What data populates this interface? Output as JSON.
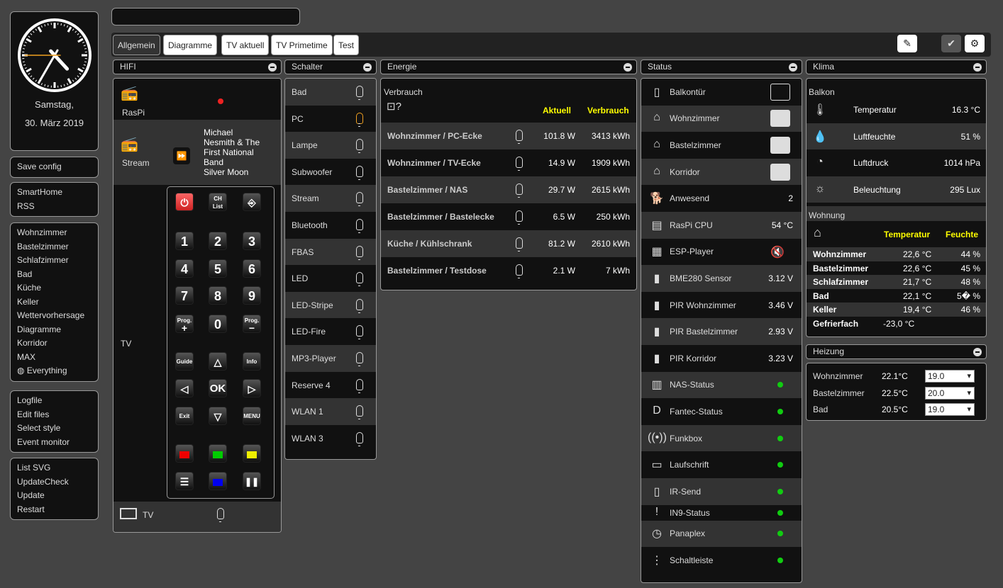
{
  "clock": {
    "day": "Samstag,",
    "date": "30. März 2019",
    "hour": 4.58,
    "minute": 35,
    "second": 45
  },
  "menus": {
    "group1": [
      "Save config"
    ],
    "group2": [
      "SmartHome",
      "RSS"
    ],
    "group3": [
      "Wohnzimmer",
      "Bastelzimmer",
      "Schlafzimmer",
      "Bad",
      "Küche",
      "Keller",
      "Wettervorhersage",
      "Diagramme",
      "Korridor",
      "MAX",
      "Everything"
    ],
    "group4": [
      "Logfile",
      "Edit files",
      "Select style",
      "Event monitor"
    ],
    "group5": [
      "List SVG",
      "UpdateCheck",
      "Update",
      "Restart"
    ]
  },
  "tabs": [
    "Allgemein",
    "Diagramme",
    "TV aktuell",
    "TV Primetime",
    "Test"
  ],
  "toolbar": {
    "edit_icon": "pencil-icon",
    "check_icon": "check-icon",
    "settings_icon": "gear-icon"
  },
  "hifi": {
    "title": "HIFI",
    "raspi": "RasPi",
    "stream": "Stream",
    "track": [
      "Michael",
      "Nesmith & The",
      "First National",
      "Band",
      "Silver Moon"
    ],
    "tv": "TV",
    "tv_bottom": "TV",
    "remote": {
      "ch_list": "CH List",
      "keys": [
        "1",
        "2",
        "3",
        "4",
        "5",
        "6",
        "7",
        "8",
        "9",
        "0"
      ],
      "prog_plus": "Prog.",
      "prog_minus": "Prog.",
      "guide": "Guide",
      "info": "Info",
      "ok": "OK",
      "exit": "Exit",
      "menu": "MENU"
    }
  },
  "schalter": {
    "title": "Schalter",
    "items": [
      {
        "label": "Bad",
        "on": false
      },
      {
        "label": "PC",
        "on": true
      },
      {
        "label": "Lampe",
        "on": false
      },
      {
        "label": "Subwoofer",
        "on": false
      },
      {
        "label": "Stream",
        "on": false
      },
      {
        "label": "Bluetooth",
        "on": false
      },
      {
        "label": "FBAS",
        "on": false
      },
      {
        "label": "LED",
        "on": false
      },
      {
        "label": "LED-Stripe",
        "on": false
      },
      {
        "label": "LED-Fire",
        "on": false
      },
      {
        "label": "MP3-Player",
        "on": false
      },
      {
        "label": "Reserve 4",
        "on": false
      },
      {
        "label": "WLAN 1",
        "on": false
      },
      {
        "label": "WLAN 3",
        "on": false
      }
    ]
  },
  "energie": {
    "title": "Energie",
    "section": "Verbrauch",
    "col_aktuell": "Aktuell",
    "col_verbrauch": "Verbrauch",
    "rows": [
      {
        "name": "Wohnzimmer / PC-Ecke",
        "aktuell": "101.8 W",
        "verbrauch": "3413 kWh"
      },
      {
        "name": "Wohnzimmer / TV-Ecke",
        "aktuell": "14.9 W",
        "verbrauch": "1909 kWh"
      },
      {
        "name": "Bastelzimmer / NAS",
        "aktuell": "29.7 W",
        "verbrauch": "2615 kWh"
      },
      {
        "name": "Bastelzimmer / Bastelecke",
        "aktuell": "6.5 W",
        "verbrauch": "250 kWh"
      },
      {
        "name": "Küche / Kühlschrank",
        "aktuell": "81.2 W",
        "verbrauch": "2610 kWh"
      },
      {
        "name": "Bastelzimmer / Testdose",
        "aktuell": "2.1 W",
        "verbrauch": "7 kWh"
      }
    ]
  },
  "status": {
    "title": "Status",
    "rows": [
      {
        "label": "Balkontür",
        "value": "",
        "icon": "door-icon"
      },
      {
        "label": "Wohnzimmer",
        "value": "",
        "icon": "home-icon"
      },
      {
        "label": "Bastelzimmer",
        "value": "",
        "icon": "absent-icon"
      },
      {
        "label": "Korridor",
        "value": "",
        "icon": "absent-icon"
      },
      {
        "label": "Anwesend",
        "value": "2",
        "icon": "dog-icon"
      },
      {
        "label": "RasPi CPU",
        "value": "54 °C",
        "icon": "sd-card-icon"
      },
      {
        "label": "ESP-Player",
        "value": "",
        "icon": "radio-icon"
      },
      {
        "label": "BME280 Sensor",
        "value": "3.12 V",
        "icon": "battery-icon"
      },
      {
        "label": "PIR Wohnzimmer",
        "value": "3.46 V",
        "icon": "battery-icon"
      },
      {
        "label": "PIR Bastelzimmer",
        "value": "2.93 V",
        "icon": "battery-icon"
      },
      {
        "label": "PIR Korridor",
        "value": "3.23 V",
        "icon": "battery-icon"
      },
      {
        "label": "NAS-Status",
        "value": "",
        "icon": "nas-icon"
      },
      {
        "label": "Fantec-Status",
        "value": "",
        "icon": "dvb-icon"
      },
      {
        "label": "Funkbox",
        "value": "",
        "icon": "antenna-icon"
      },
      {
        "label": "Laufschrift",
        "value": "",
        "icon": "display-icon"
      },
      {
        "label": "IR-Send",
        "value": "",
        "icon": "remote-icon"
      },
      {
        "label": "IN9-Status",
        "value": "",
        "icon": "thermometer-icon"
      },
      {
        "label": "Panaplex",
        "value": "",
        "icon": "stopwatch-icon"
      },
      {
        "label": "Schaltleiste",
        "value": "",
        "icon": "power-strip-icon"
      }
    ]
  },
  "klima": {
    "title": "Klima",
    "balkon": "Balkon",
    "balkon_rows": [
      {
        "label": "Temperatur",
        "value": "16.3 °C"
      },
      {
        "label": "Luftfeuchte",
        "value": "51 %"
      },
      {
        "label": "Luftdruck",
        "value": "1014 hPa"
      },
      {
        "label": "Beleuchtung",
        "value": "295 Lux"
      }
    ],
    "wohnung": "Wohnung",
    "col_temp": "Temperatur",
    "col_feuchte": "Feuchte",
    "wohnung_rows": [
      {
        "room": "Wohnzimmer",
        "temp": "22,6 °C",
        "hum": "44 %"
      },
      {
        "room": "Bastelzimmer",
        "temp": "22,6 °C",
        "hum": "45 %"
      },
      {
        "room": "Schlafzimmer",
        "temp": "21,7 °C",
        "hum": "48 %"
      },
      {
        "room": "Bad",
        "temp": "22,1 °C",
        "hum": "5� %"
      },
      {
        "room": "Keller",
        "temp": "19,4 °C",
        "hum": "46 %"
      },
      {
        "room": "Gefrierfach",
        "temp": "-23,0 °C",
        "hum": ""
      }
    ]
  },
  "heizung": {
    "title": "Heizung",
    "rows": [
      {
        "room": "Wohnzimmer",
        "temp": "22.1°C",
        "set": "19.0"
      },
      {
        "room": "Bastelzimmer",
        "temp": "22.5°C",
        "set": "20.0"
      },
      {
        "room": "Bad",
        "temp": "20.5°C",
        "set": "19.0"
      }
    ]
  }
}
